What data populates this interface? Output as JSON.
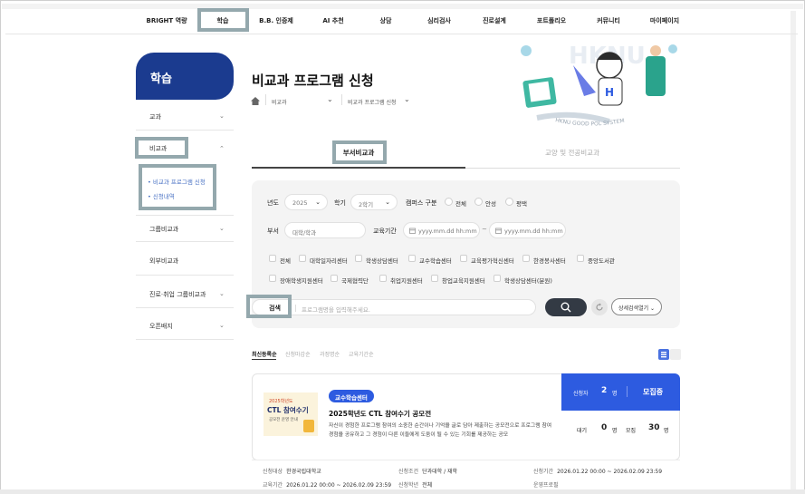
{
  "gnb": {
    "items": [
      "BRIGHT 역량",
      "학습",
      "B.B. 인증제",
      "AI 추천",
      "상담",
      "심리검사",
      "진로설계",
      "포트폴리오",
      "커뮤니티",
      "마이페이지"
    ]
  },
  "sidebar": {
    "title": "학습",
    "items": [
      {
        "label": "교과",
        "chevron": "⌄"
      },
      {
        "label": "비교과",
        "chevron": "⌃"
      },
      {
        "label": "그룹비교과",
        "chevron": "⌄"
      },
      {
        "label": "외부비교과",
        "chevron": ""
      },
      {
        "label": "진로·취업 그룹비교과",
        "chevron": "⌄"
      },
      {
        "label": "오픈배지",
        "chevron": "⌄"
      }
    ],
    "sub_items": [
      "• 비교과 프로그램 신청",
      "• 신청내역"
    ]
  },
  "header": {
    "title": "비교과 프로그램 신청",
    "breadcrumb": [
      "비교과",
      "비교과 프로그램 신청"
    ],
    "chevron": "⌄"
  },
  "illustration": {
    "watermark": "HKNU",
    "arc_text": "HKNU GOOD POL SYSTEM"
  },
  "tabs": [
    "부서비교과",
    "교양 및 전공비교과"
  ],
  "filters": {
    "year_label": "년도",
    "year_value": "2025",
    "semester_label": "학기",
    "semester_value": "2학기",
    "campus_label": "캠퍼스 구분",
    "campus_options": [
      "전체",
      "안성",
      "평택"
    ],
    "dept_label": "부서",
    "dept_placeholder": "대학/학과",
    "period_label": "교육기간",
    "date_placeholder": "yyyy.mm.dd hh:mm",
    "date_sep": "~",
    "checkboxes": [
      "전체",
      "대학일자리센터",
      "학생상담센터",
      "교수학습센터",
      "교육평가혁신센터",
      "한경봉사센터",
      "중앙도서관",
      "장애학생지원센터",
      "국제협력단",
      "취업지원센터",
      "창업교육지원센터",
      "학생상담센터(분원)"
    ],
    "search_label": "검색",
    "search_placeholder": "프로그램명을 입력해주세요.",
    "detail_label": "상세검색열기"
  },
  "sort": {
    "items": [
      "최신등록순",
      "신청마감순",
      "과정명순",
      "교육기간순"
    ],
    "active": 0
  },
  "card": {
    "badge": "교수학습센터",
    "title": "2025학년도 CTL 참여수기 공모전",
    "description": "자신이 경험한 프로그램 참여의 소중한 순간이나 기억을 글로 담아 제출하는 공모전으로 프로그램 참여 경험을 공유하고 그 경험이 다른 이들에게 도움이 될 수 있는 기회를 제공하는 공모",
    "thumbnail_lines": [
      "2025학년도",
      "CTL 참여수기",
      "공모전 운영 안내"
    ],
    "applicants_label": "신청자",
    "applicants_value": "2",
    "unit": "명",
    "status": "모집중",
    "wait_label": "대기",
    "wait_value": "0",
    "recruit_label": "모집",
    "recruit_value": "30",
    "info": [
      {
        "k": "신청대상",
        "v": "한경국립대학교"
      },
      {
        "k": "신청조건",
        "v": "단과대학 / 재학"
      },
      {
        "k": "신청기간",
        "v": "2026.01.22 00:00 ~ 2026.02.09 23:59"
      },
      {
        "k": "교육기간",
        "v": "2026.01.22 00:00 ~ 2026.02.09 23:59"
      },
      {
        "k": "신청학년",
        "v": "전체"
      },
      {
        "k": "운영프로필",
        "v": ""
      }
    ]
  },
  "colors": {
    "primary_navy": "#1b3b8f",
    "accent_blue": "#2d5be0",
    "highlight_box": "#94a8ad"
  },
  "icons": [
    "home-icon",
    "search-icon",
    "reset-icon",
    "grid-view-icon",
    "list-view-icon",
    "calendar-icon"
  ]
}
